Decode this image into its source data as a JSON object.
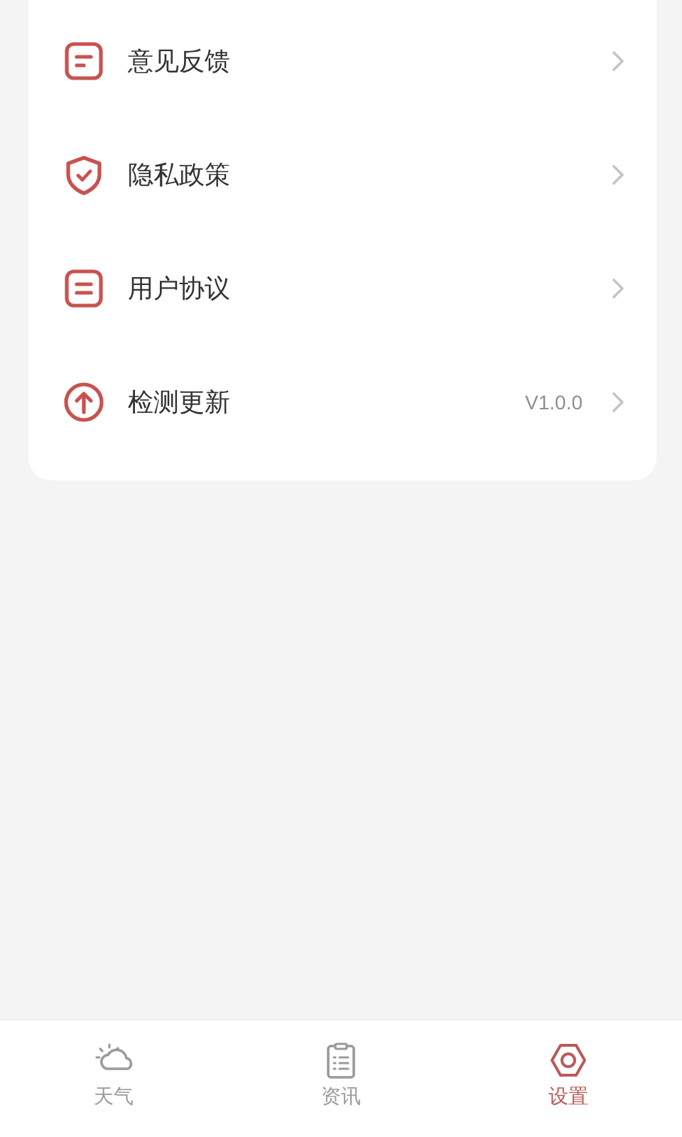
{
  "settings": [
    {
      "kind": "feedback",
      "label": "意见反馈"
    },
    {
      "kind": "privacy",
      "label": "隐私政策"
    },
    {
      "kind": "agreement",
      "label": "用户协议"
    },
    {
      "kind": "update",
      "label": "检测更新",
      "value": "V1.0.0"
    }
  ],
  "tabs": [
    {
      "kind": "weather",
      "label": "天气",
      "selected": false
    },
    {
      "kind": "news",
      "label": "资讯",
      "selected": false
    },
    {
      "kind": "settings",
      "label": "设置",
      "selected": true
    }
  ]
}
